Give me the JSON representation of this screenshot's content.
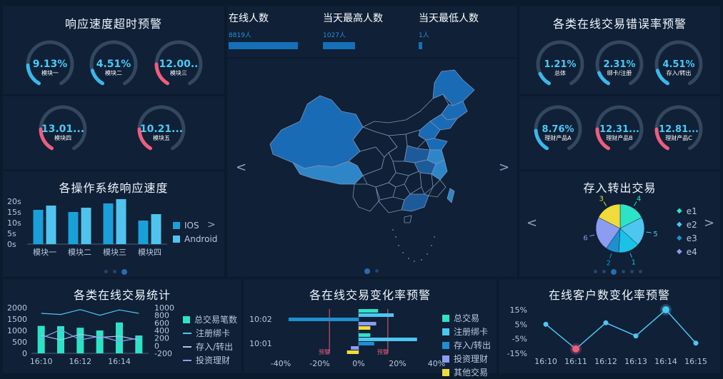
{
  "panels": {
    "response_title": "响应速度超时预警",
    "errors_title": "各类在线交易错误率预警",
    "os_title": "各操作系统响应速度",
    "pie_title": "存入转出交易",
    "stats_title": "各类在线交易统计",
    "change_title": "各在线交易变化率预警",
    "customer_title": "在线客户数变化率预警"
  },
  "gauges_response_top": [
    {
      "value": "9.13%",
      "label": "模块一",
      "pct": 0.0913,
      "color": "#3ab8ec"
    },
    {
      "value": "4.51%",
      "label": "模块二",
      "pct": 0.0451,
      "color": "#3ab8ec"
    },
    {
      "value": "12.00..",
      "label": "模块三",
      "pct": 0.12,
      "color": "#ef5d7d"
    }
  ],
  "gauges_response_bottom": [
    {
      "value": "13.01...",
      "label": "模块四",
      "pct": 0.1301,
      "color": "#ef5d7d"
    },
    {
      "value": "10.21...",
      "label": "模块五",
      "pct": 0.1021,
      "color": "#ef5d7d"
    }
  ],
  "gauges_error_top": [
    {
      "value": "1.21%",
      "label": "总体",
      "pct": 0.0121,
      "color": "#3ab8ec"
    },
    {
      "value": "2.31%",
      "label": "绑卡/注册",
      "pct": 0.0231,
      "color": "#3ab8ec"
    },
    {
      "value": "4.51%",
      "label": "存入/转出",
      "pct": 0.0451,
      "color": "#3ab8ec"
    }
  ],
  "gauges_error_bottom": [
    {
      "value": "8.76%",
      "label": "理财产品A",
      "pct": 0.0876,
      "color": "#3ab8ec"
    },
    {
      "value": "12.31...",
      "label": "理财产品B",
      "pct": 0.1231,
      "color": "#ef5d7d"
    },
    {
      "value": "12.81...",
      "label": "理财产品C",
      "pct": 0.1281,
      "color": "#ef5d7d"
    }
  ],
  "stats": [
    {
      "label": "在线人数",
      "value": "8819人",
      "pct": 1.0
    },
    {
      "label": "当天最高人数",
      "value": "1027人",
      "pct": 0.46
    },
    {
      "label": "当天最低人数",
      "value": "1人",
      "pct": 0.05
    }
  ],
  "map": {
    "highlight_color": "#1a6bb5",
    "mid_color": "#1d5a9a",
    "light_color": "#2e86c9",
    "base_color": "#0f2037",
    "border_color": "#7b95b8"
  },
  "chart_data": [
    {
      "id": "os_response",
      "type": "bar",
      "categories": [
        "模块一",
        "模块二",
        "模块三",
        "模块四"
      ],
      "series": [
        {
          "name": "IOS",
          "values": [
            16,
            15,
            19,
            11
          ],
          "color": "#1aa0d8"
        },
        {
          "name": "Android",
          "values": [
            18,
            17,
            21,
            14
          ],
          "color": "#4fc3ee"
        }
      ],
      "ylim": [
        0,
        20
      ],
      "yticks": [
        "0s",
        "5s",
        "10s",
        "15s",
        "20s"
      ]
    },
    {
      "id": "deposit_pie",
      "type": "pie",
      "slices": [
        {
          "label": "1",
          "value": 1.6,
          "color": "#1ac2e5"
        },
        {
          "label": "2",
          "value": 1.0,
          "color": "#1f8fd0"
        },
        {
          "label": "3",
          "value": 2.0,
          "color": "#f0db3b"
        },
        {
          "label": "4",
          "value": 2.0,
          "color": "#2de3c6"
        },
        {
          "label": "5",
          "value": 2.2,
          "color": "#4dc6f0"
        },
        {
          "label": "6",
          "value": 2.6,
          "color": "#8b9df0"
        }
      ],
      "legend": [
        {
          "name": "e1",
          "color": "#2de3c6"
        },
        {
          "name": "e2",
          "color": "#4dc6f0"
        },
        {
          "name": "e3",
          "color": "#1f8fd0"
        },
        {
          "name": "e4",
          "color": "#8b9df0"
        }
      ]
    },
    {
      "id": "trade_stats",
      "type": "bar",
      "categories": [
        "16:10",
        "16:11",
        "16:12",
        "16:13",
        "16:14",
        "16:15"
      ],
      "x_tick_labels": [
        "16:10",
        "16:12",
        "16:14"
      ],
      "y_left": {
        "ylim": [
          0,
          2000
        ],
        "ticks": [
          "0",
          "500",
          "1000",
          "1500",
          "2000"
        ]
      },
      "y_right": {
        "ylim": [
          -200,
          1000
        ],
        "ticks": [
          "-200",
          "0",
          "200",
          "400",
          "600",
          "800",
          "1000"
        ]
      },
      "bars": {
        "name": "总交易笔数",
        "values": [
          1200,
          1190,
          1120,
          1000,
          1350,
          780
        ],
        "color": "#2de3c6"
      },
      "lines": [
        {
          "name": "注册绑卡",
          "values": [
            850,
            820,
            950,
            800,
            940,
            850
          ],
          "color": "#4dc6f0"
        },
        {
          "name": "存入/转出",
          "values": [
            270,
            150,
            300,
            220,
            250,
            150
          ],
          "color": "#a9c5e9"
        },
        {
          "name": "投资理财",
          "values": [
            200,
            420,
            150,
            250,
            110,
            200
          ],
          "color": "#8b9df0"
        }
      ],
      "legend": [
        {
          "name": "总交易笔数",
          "color": "#2de3c6",
          "kind": "box"
        },
        {
          "name": "注册绑卡",
          "color": "#4dc6f0",
          "kind": "line"
        },
        {
          "name": "存入/转出",
          "color": "#a9c5e9",
          "kind": "line"
        },
        {
          "name": "投资理财",
          "color": "#8b9df0",
          "kind": "line"
        }
      ]
    },
    {
      "id": "change_rate",
      "type": "bar",
      "orientation": "horizontal",
      "y_categories": [
        "10:02",
        "10:01"
      ],
      "xlim": [
        -40,
        40
      ],
      "x_ticks": [
        "-40%",
        "-20%",
        "0%",
        "20%",
        "40%"
      ],
      "warning_lines": [
        {
          "x": -15,
          "label": "预警"
        },
        {
          "x": 15,
          "label": "预警"
        }
      ],
      "series": [
        {
          "name": "总交易",
          "color": "#2de3c6",
          "values": {
            "10:02": 10,
            "10:01": 6
          }
        },
        {
          "name": "注册绑卡",
          "color": "#4dc6f0",
          "values": {
            "10:02": 18,
            "10:01": 30
          }
        },
        {
          "name": "存入/转出",
          "color": "#1f8fd0",
          "values": {
            "10:02": -36,
            "10:01": 8
          }
        },
        {
          "name": "投资理财",
          "color": "#8b9df0",
          "values": {
            "10:02": 9,
            "10:01": -4
          }
        },
        {
          "name": "其他交易",
          "color": "#f0db3b",
          "values": {
            "10:02": 6,
            "10:01": -6
          }
        }
      ],
      "legend": [
        {
          "name": "总交易",
          "color": "#2de3c6"
        },
        {
          "name": "注册绑卡",
          "color": "#4dc6f0"
        },
        {
          "name": "存入/转出",
          "color": "#1f8fd0"
        },
        {
          "name": "投资理财",
          "color": "#8b9df0"
        },
        {
          "name": "其他交易",
          "color": "#f0db3b"
        }
      ]
    },
    {
      "id": "customer_rate",
      "type": "line",
      "x": [
        "16:10",
        "16:11",
        "16:12",
        "16:13",
        "16:14",
        "16:15"
      ],
      "values": [
        5,
        -12,
        6,
        -3,
        15,
        -8
      ],
      "ylim": [
        -15,
        15
      ],
      "y_ticks": [
        "-15%",
        "-5%",
        "5%",
        "15%"
      ],
      "color": "#4dc6f0",
      "alert_points": [
        {
          "index": 1,
          "color": "#ef5d7d"
        },
        {
          "index": 4,
          "color": "#4dc6f0"
        }
      ]
    }
  ],
  "os_legend": [
    {
      "name": "IOS",
      "color": "#1aa0d8"
    },
    {
      "name": "Android",
      "color": "#4fc3ee"
    }
  ],
  "glyphs": {
    "prev": "<",
    "next": ">",
    "prev_small": "<",
    "next_small": ">"
  }
}
